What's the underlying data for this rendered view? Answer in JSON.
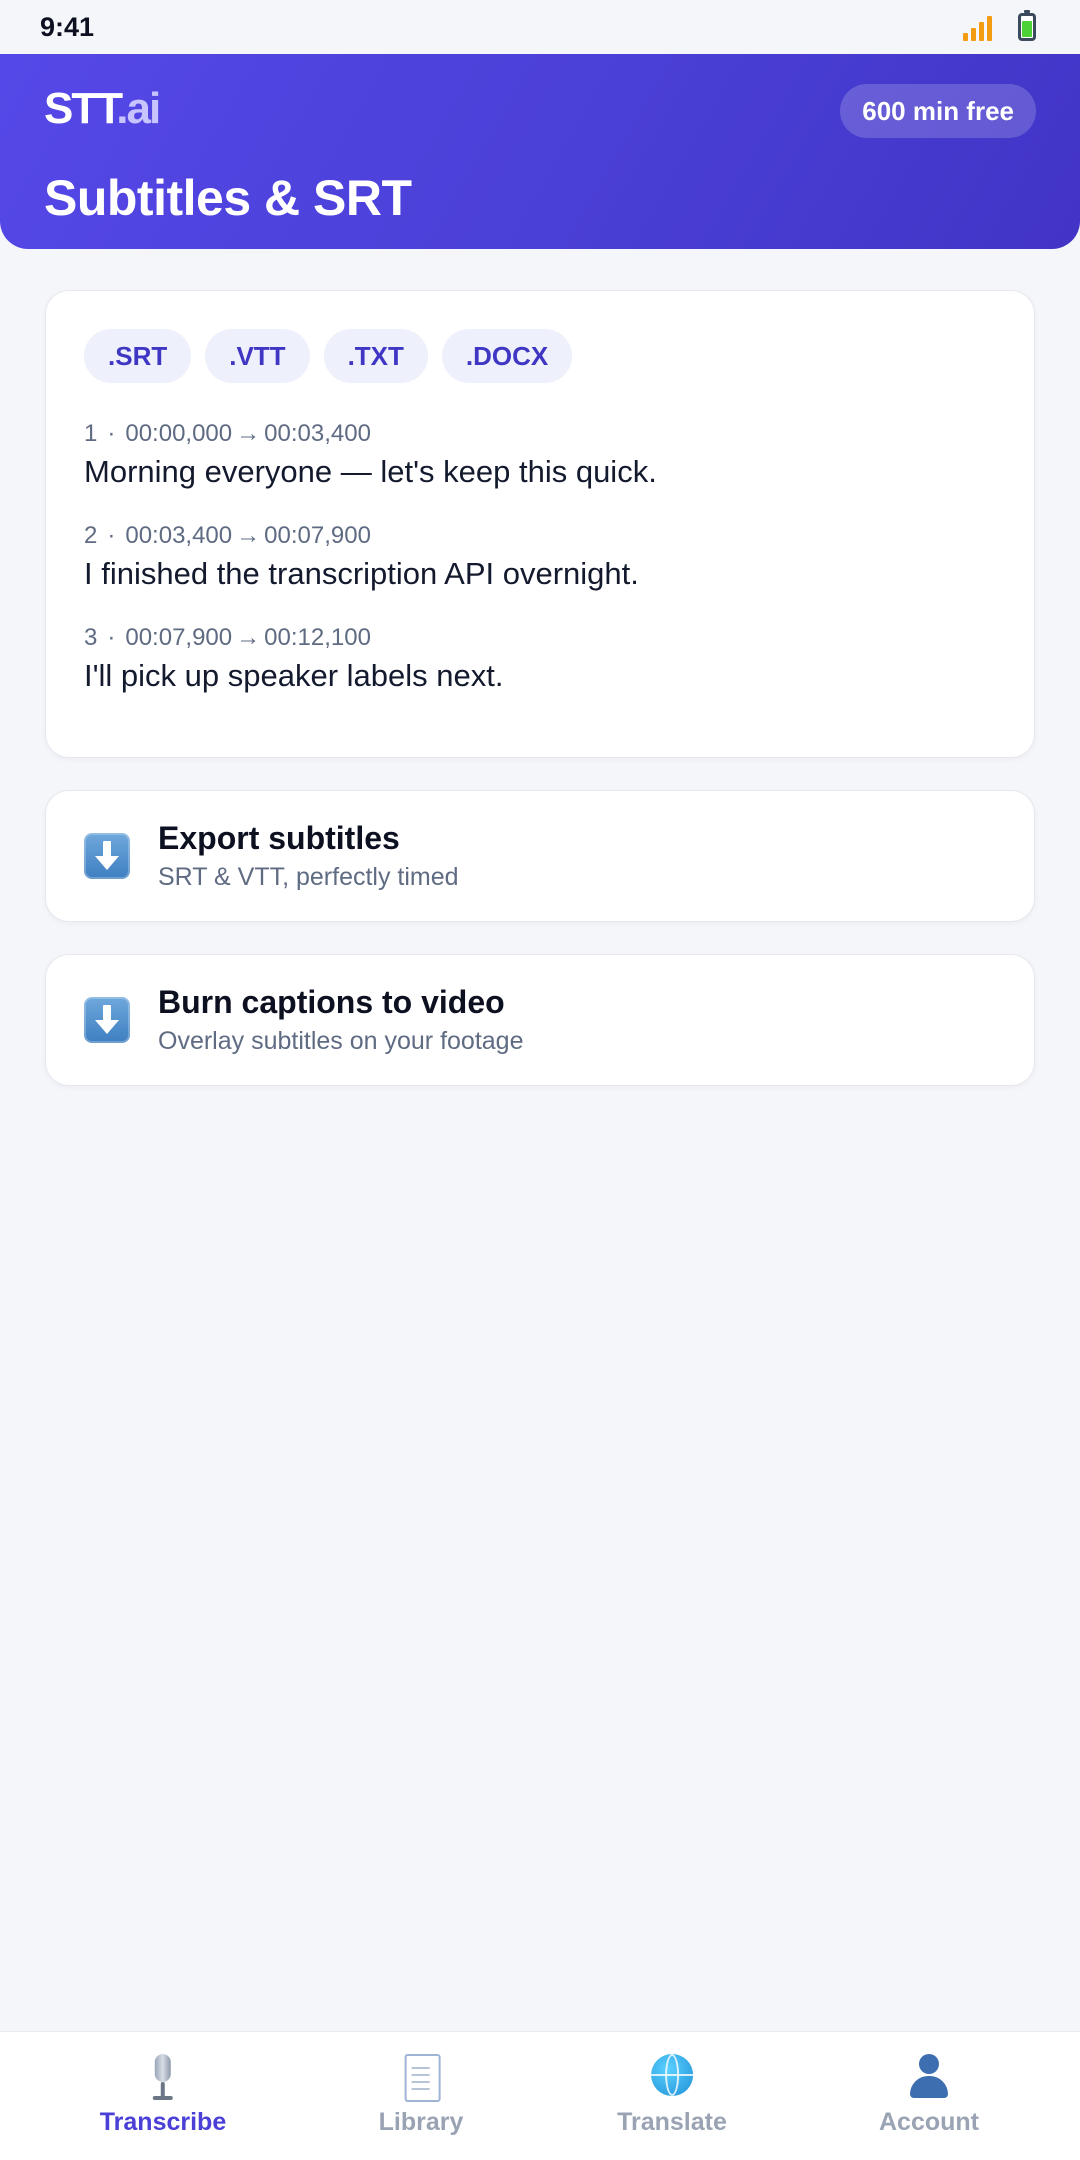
{
  "status_bar": {
    "time": "9:41",
    "icons": [
      "signal-icon",
      "battery-icon"
    ]
  },
  "header": {
    "logo_main": "STT",
    "logo_dot": ".",
    "logo_suffix": "ai",
    "badge": "600 min free",
    "title": "Subtitles & SRT"
  },
  "formats": [
    ".SRT",
    ".VTT",
    ".TXT",
    ".DOCX"
  ],
  "cues": [
    {
      "index": "1",
      "start": "00:00,000",
      "end": "00:03,400",
      "text": "Morning everyone — let's keep this quick."
    },
    {
      "index": "2",
      "start": "00:03,400",
      "end": "00:07,900",
      "text": "I finished the transcription API overnight."
    },
    {
      "index": "3",
      "start": "00:07,900",
      "end": "00:12,100",
      "text": "I'll pick up speaker labels next."
    }
  ],
  "cue_separator": "·",
  "cue_arrow": "→",
  "actions": [
    {
      "icon": "download-icon",
      "title": "Export subtitles",
      "subtitle": "SRT & VTT, perfectly timed"
    },
    {
      "icon": "download-icon",
      "title": "Burn captions to video",
      "subtitle": "Overlay subtitles on your footage"
    }
  ],
  "nav": {
    "active": "Transcribe",
    "active_color": "#4a3fd6",
    "inactive_color": "#9aa3b4",
    "items": [
      {
        "label": "Transcribe",
        "icon": "microphone-icon"
      },
      {
        "label": "Library",
        "icon": "document-icon"
      },
      {
        "label": "Translate",
        "icon": "globe-icon"
      },
      {
        "label": "Account",
        "icon": "person-icon"
      }
    ]
  },
  "colors": {
    "header_gradient_start": "#5548e8",
    "header_gradient_end": "#4134c6",
    "chip_bg": "#eef0fc",
    "chip_text": "#3f36c4",
    "background": "#f5f6fa"
  }
}
